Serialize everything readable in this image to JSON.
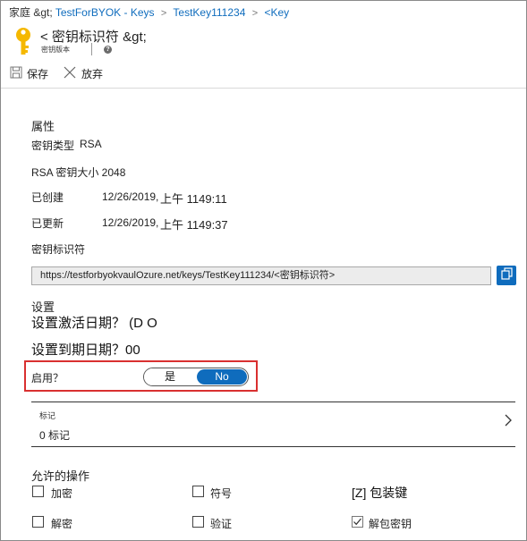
{
  "breadcrumb": {
    "home": "家庭 &gt;",
    "items": [
      "TestForBYOK - Keys",
      "TestKey111234",
      "<Key"
    ],
    "separator": ">"
  },
  "header": {
    "title": "< 密钥标识符 &gt;",
    "subtitle": "密钥版本",
    "info": "?",
    "icon": "key-icon",
    "icon_color": "#f5b800"
  },
  "toolbar": {
    "save_label": "保存",
    "discard_label": "放弃"
  },
  "properties": {
    "heading": "属性",
    "key_type_label": "密钥类型",
    "key_type_value": "RSA",
    "key_size_text": "RSA 密钥大小 2048",
    "created_label": "已创建",
    "created_date": "12/26/2019,",
    "created_time": "上午 1149:11",
    "updated_label": "已更新",
    "updated_date": "12/26/2019,",
    "updated_time": "上午 1149:37",
    "identifier_label": "密钥标识符",
    "identifier_value": "https://testforbyokvaulOzure.net/keys/TestKey111234/<密钥标识符>"
  },
  "settings": {
    "heading": "设置",
    "activation_text": "设置激活日期？ (D O",
    "expiry_text": "设置到期日期？00",
    "enabled_label": "启用？",
    "toggle_yes": "是",
    "toggle_no": "No",
    "toggle_selected": "No"
  },
  "tags": {
    "label": "标记",
    "value": "0 标记"
  },
  "operations": {
    "heading": "允许的操作",
    "items": [
      {
        "label": "加密",
        "checked": false
      },
      {
        "label": "符号",
        "checked": false
      },
      {
        "label": "[Z] 包装键",
        "checked": false
      },
      {
        "label": "解密",
        "checked": false
      },
      {
        "label": "验证",
        "checked": false
      },
      {
        "label": "解包密钥",
        "checked": true
      }
    ]
  },
  "colors": {
    "accent": "#0f6cbd",
    "highlight": "#d93030"
  }
}
